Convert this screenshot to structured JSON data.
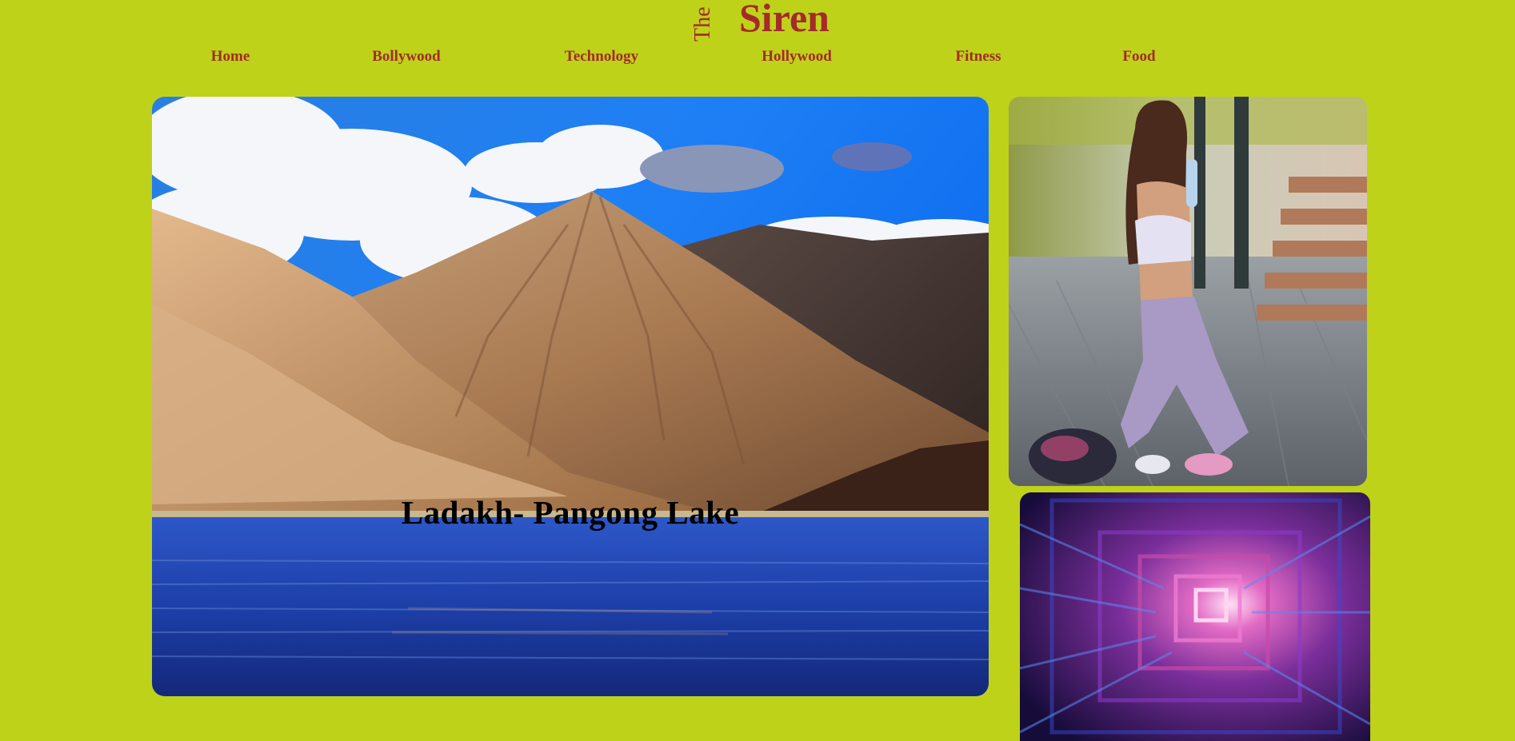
{
  "logo": {
    "prefix": "The",
    "name": "Siren"
  },
  "nav": {
    "items": [
      "Home",
      "Bollywood",
      "Technology",
      "Hollywood",
      "Fitness",
      "Food"
    ]
  },
  "hero": {
    "caption": "Ladakh- Pangong Lake"
  },
  "colors": {
    "background": "#bed21a",
    "brand": "#a52a2a"
  }
}
